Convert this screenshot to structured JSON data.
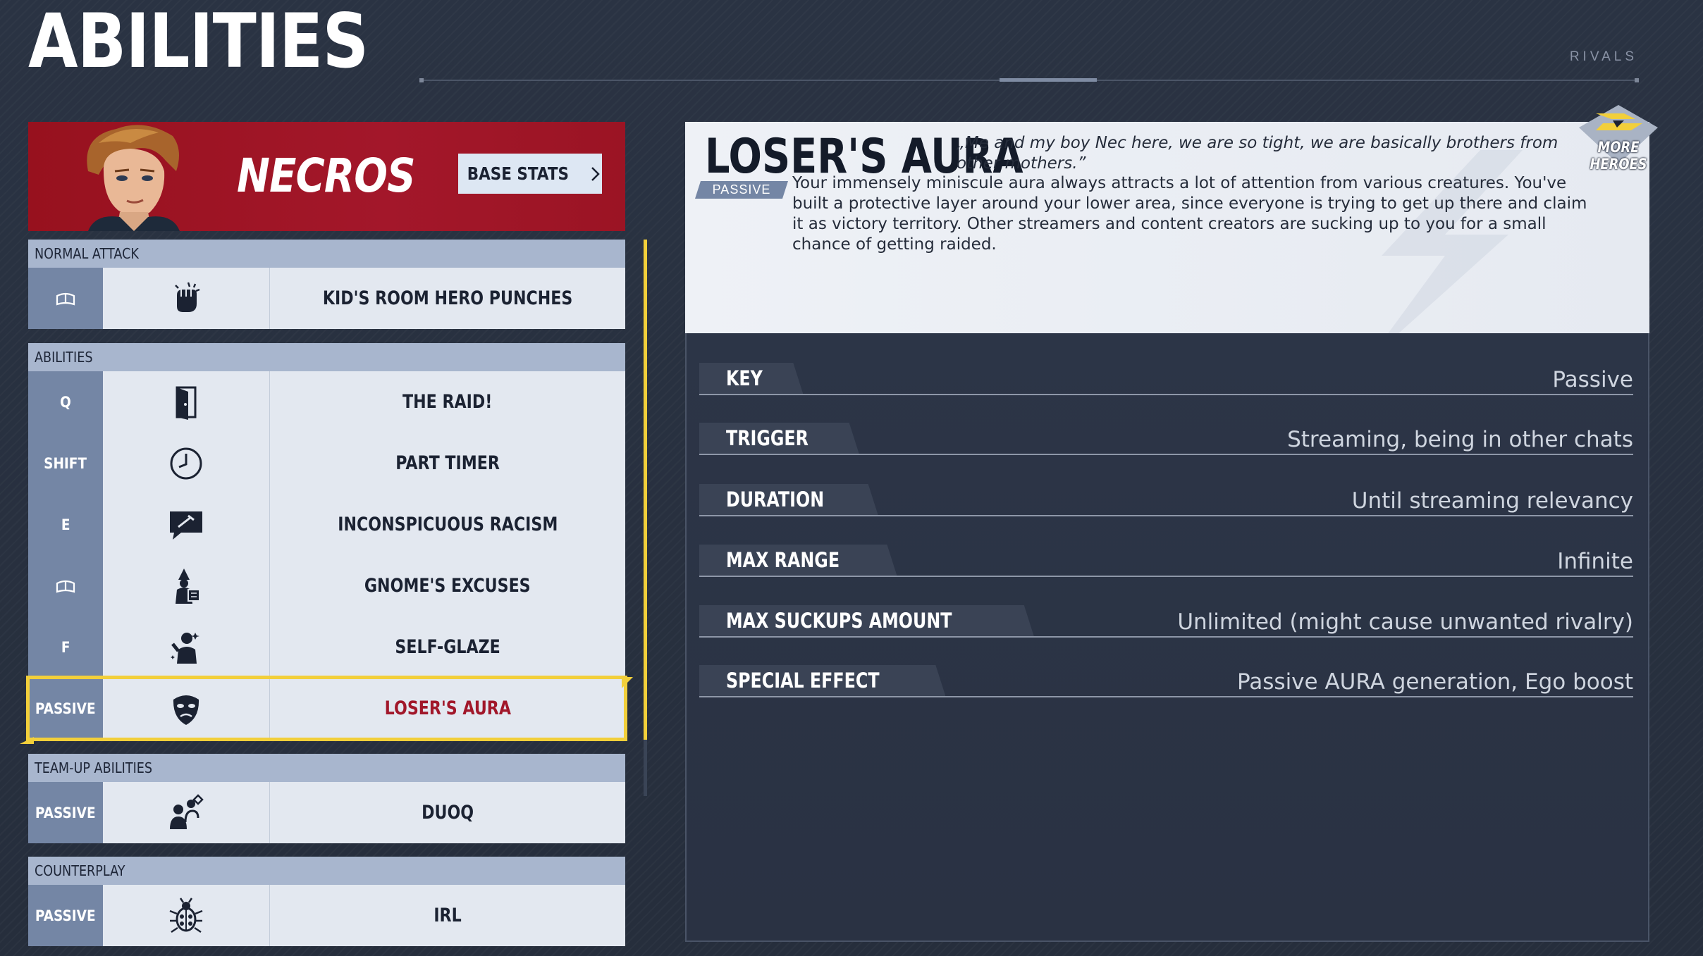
{
  "header": {
    "title": "ABILITIES",
    "brand": "RIVALS"
  },
  "hero": {
    "name": "NECROS",
    "base_stats_label": "BASE STATS",
    "banner_color": "#a3172a"
  },
  "sections": {
    "normal_attack": "NORMAL ATTACK",
    "abilities": "ABILITIES",
    "team_up": "TEAM-UP ABILITIES",
    "counterplay": "COUNTERPLAY"
  },
  "normal_attack": {
    "key_icon": "mouse-icon",
    "icon": "fist-icon",
    "name": "KID'S ROOM HERO PUNCHES"
  },
  "abilities": [
    {
      "key": "Q",
      "icon": "door-icon",
      "name": "THE RAID!"
    },
    {
      "key": "SHIFT",
      "icon": "clock-icon",
      "name": "PART TIMER"
    },
    {
      "key": "E",
      "icon": "speech-bubble-icon",
      "name": "INCONSPICUOUS RACISM"
    },
    {
      "key_icon": "mouse-icon",
      "icon": "gnome-icon",
      "name": "GNOME'S EXCUSES"
    },
    {
      "key": "F",
      "icon": "selfie-figure-icon",
      "name": "SELF-GLAZE"
    },
    {
      "key": "PASSIVE",
      "icon": "sad-mask-icon",
      "name": "LOSER'S AURA",
      "selected": true
    }
  ],
  "team_up": {
    "key": "PASSIVE",
    "icon": "duo-icon",
    "name": "DUOQ"
  },
  "counterplay": {
    "key": "PASSIVE",
    "icon": "bug-icon",
    "name": "IRL"
  },
  "detail": {
    "title": "LOSER'S AURA",
    "quote": "„Me and my boy Nec here, we are so tight, we are basically brothers from other mothers.”",
    "badge": "PASSIVE",
    "description": "Your immensely miniscule aura always attracts a lot of attention from various creatures. You've built a protective layer around your lower area, since everyone is trying to get up there and claim it as victory territory. Other streamers and content creators are sucking up to you for a small chance of getting raided."
  },
  "stats": [
    {
      "label": "KEY",
      "value": "Passive"
    },
    {
      "label": "TRIGGER",
      "value": "Streaming, being in other chats"
    },
    {
      "label": "DURATION",
      "value": "Until streaming relevancy"
    },
    {
      "label": "MAX RANGE",
      "value": "Infinite"
    },
    {
      "label": "MAX SUCKUPS AMOUNT",
      "value": "Unlimited (might cause unwanted rivalry)"
    },
    {
      "label": "SPECIAL EFFECT",
      "value": "Passive AURA generation, Ego boost"
    }
  ],
  "logo": {
    "text": "MORE HEROES"
  },
  "colors": {
    "accent_yellow": "#f2cf3a",
    "selected_text": "#a1172a",
    "key_column": "#7486a5"
  }
}
